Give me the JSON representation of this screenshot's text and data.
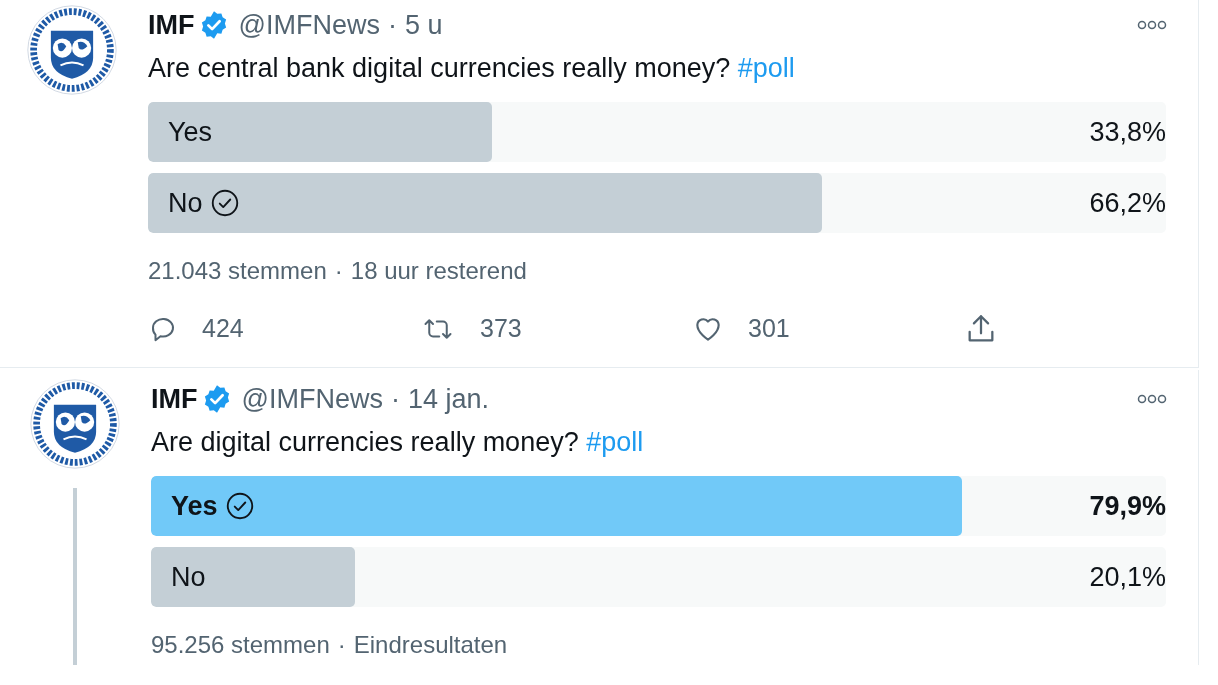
{
  "tweets": [
    {
      "name": "IMF",
      "verified": true,
      "handle": "@IMFNews",
      "header_separator": "·",
      "time": "5 u",
      "text": "Are central bank digital currencies really money? ",
      "hashtag": "#poll",
      "thread": false,
      "options": [
        {
          "label": "Yes",
          "percent": "33,8%",
          "level": 0.338,
          "selected": false,
          "leading": false
        },
        {
          "label": "No",
          "percent": "66,2%",
          "level": 0.662,
          "selected": true,
          "leading": false
        }
      ],
      "votes": "21.043 stemmen",
      "footer_separator": "·",
      "status": "18 uur resterend",
      "actions": [
        {
          "kind": "reply",
          "count": "424"
        },
        {
          "kind": "retweet",
          "count": "373"
        },
        {
          "kind": "like",
          "count": "301"
        },
        {
          "kind": "share"
        }
      ]
    },
    {
      "name": "IMF",
      "verified": true,
      "handle": "@IMFNews",
      "header_separator": "·",
      "time": "14 jan.",
      "text": "Are digital currencies really money? ",
      "hashtag": "#poll",
      "thread": true,
      "options": [
        {
          "label": "Yes",
          "percent": "79,9%",
          "level": 0.799,
          "selected": true,
          "leading": true
        },
        {
          "label": "No",
          "percent": "20,1%",
          "level": 0.201,
          "selected": false,
          "leading": false
        }
      ],
      "votes": "95.256 stemmen",
      "footer_separator": "·",
      "status": "Eindresultaten"
    }
  ]
}
